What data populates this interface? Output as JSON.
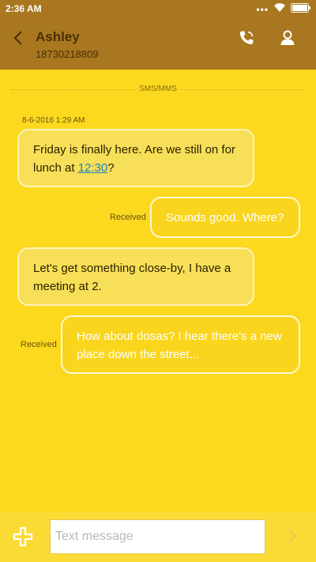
{
  "status_bar": {
    "time": "2:36 AM",
    "more_indicator": "•••"
  },
  "header": {
    "contact_name": "Ashley",
    "contact_number": "18730218809"
  },
  "channel": {
    "label": "SMS/MMS"
  },
  "conversation": {
    "timestamp": "8-6-2016 1:29 AM",
    "messages": [
      {
        "direction": "incoming",
        "text_before_link": "Friday is finally here. Are we still on for lunch at ",
        "link": "12:30",
        "text_after_link": "?"
      },
      {
        "direction": "outgoing",
        "status": "Received",
        "text": "Sounds good. Where?"
      },
      {
        "direction": "incoming",
        "text": "Let's get something close-by, I have a meeting at 2."
      },
      {
        "direction": "outgoing",
        "status": "Received",
        "text": "How about dosas? I hear there's a new place down the street..."
      }
    ]
  },
  "composer": {
    "placeholder": "Text message"
  },
  "icons": {
    "back": "chevron-left-icon",
    "call": "phone-icon",
    "contact": "person-icon",
    "add": "plus-icon",
    "send": "chevron-right-icon",
    "wifi": "wifi-icon",
    "battery": "battery-icon"
  },
  "colors": {
    "header_bg": "#a8771f",
    "chat_bg": "#fcd91f",
    "link": "#1e83c7"
  }
}
